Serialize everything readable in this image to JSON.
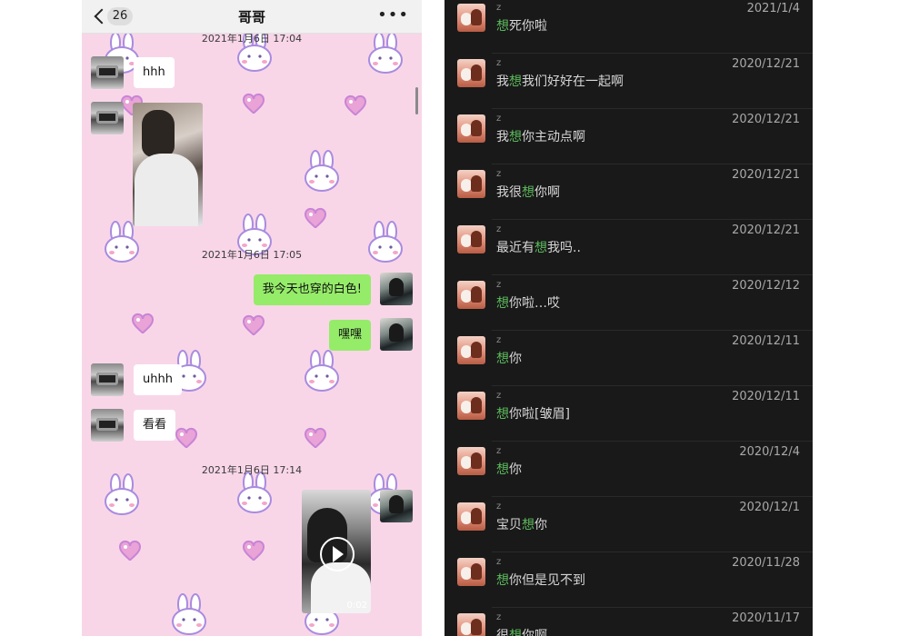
{
  "chat": {
    "unread_count": "26",
    "title": "哥哥",
    "more_label": "•••",
    "timestamps": [
      "2021年1月6日 17:04",
      "2021年1月6日 17:05",
      "2021年1月6日 17:14"
    ],
    "messages": {
      "hhh": "hhh",
      "white_outfit": "我今天也穿的白色!",
      "heihei": "嘿嘿",
      "uhhh": "uhhh",
      "kankan": "看看"
    },
    "video_duration": "0:02"
  },
  "search_results": [
    {
      "name": "z",
      "date": "2021/1/4",
      "pre": "",
      "hl": "想",
      "post": "死你啦"
    },
    {
      "name": "z",
      "date": "2020/12/21",
      "pre": "我",
      "hl": "想",
      "post": "我们好好在一起啊"
    },
    {
      "name": "z",
      "date": "2020/12/21",
      "pre": "我",
      "hl": "想",
      "post": "你主动点啊"
    },
    {
      "name": "z",
      "date": "2020/12/21",
      "pre": "我很",
      "hl": "想",
      "post": "你啊"
    },
    {
      "name": "z",
      "date": "2020/12/21",
      "pre": "最近有",
      "hl": "想",
      "post": "我吗.."
    },
    {
      "name": "z",
      "date": "2020/12/12",
      "pre": "",
      "hl": "想",
      "post": "你啦…哎"
    },
    {
      "name": "z",
      "date": "2020/12/11",
      "pre": "",
      "hl": "想",
      "post": "你"
    },
    {
      "name": "z",
      "date": "2020/12/11",
      "pre": "",
      "hl": "想",
      "post": "你啦[皱眉]"
    },
    {
      "name": "z",
      "date": "2020/12/4",
      "pre": "",
      "hl": "想",
      "post": "你"
    },
    {
      "name": "z",
      "date": "2020/12/1",
      "pre": "宝贝",
      "hl": "想",
      "post": "你"
    },
    {
      "name": "z",
      "date": "2020/11/28",
      "pre": "",
      "hl": "想",
      "post": "你但是见不到"
    },
    {
      "name": "z",
      "date": "2020/11/17",
      "pre": "很",
      "hl": "想",
      "post": "你啊"
    }
  ],
  "colors": {
    "chat_background": "#f8d6e8",
    "sent_bubble": "#95ec69",
    "list_background": "#191919",
    "highlight": "#5bb85b"
  }
}
